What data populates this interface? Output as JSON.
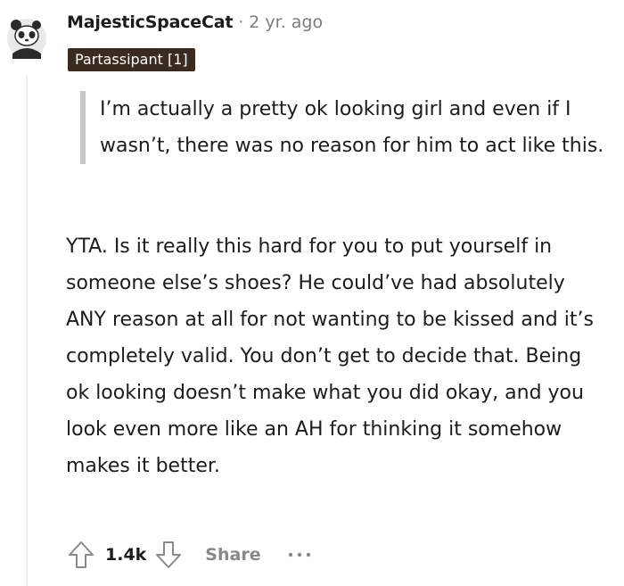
{
  "comment": {
    "author": "MajesticSpaceCat",
    "separator": "·",
    "time_ago": "2 yr. ago",
    "flair": "Partassipant [1]",
    "quote": "I’m actually a pretty ok looking girl and even if I wasn’t, there was no reason for him to act like this.",
    "body": "YTA. Is it really this hard for you to put yourself in someone else’s shoes? He could’ve had absolutely ANY reason at all for not wanting to be kissed and it’s completely valid. You don’t get to decide that. Being ok looking doesn’t make what you did okay, and you look even more like an AH for thinking it somehow makes it better.",
    "score": "1.4k",
    "share_label": "Share"
  },
  "icons": {
    "avatar": "panda-avatar-icon",
    "upvote": "upvote-arrow-icon",
    "downvote": "downvote-arrow-icon",
    "more": "more-options-icon"
  },
  "colors": {
    "flair_background": "#3b2a1f",
    "quote_bar": "#c8c8c8",
    "muted_text": "#878a8c",
    "thread_line": "#edeff1"
  }
}
